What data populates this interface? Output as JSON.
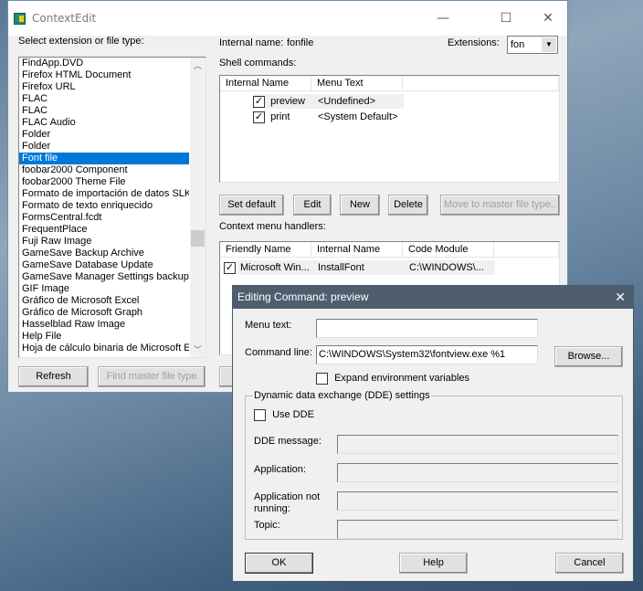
{
  "main": {
    "title": "ContextEdit",
    "select_label": "Select extension or file type:",
    "internal_name_label": "Internal name:",
    "internal_name_value": "fonfile",
    "extensions_label": "Extensions:",
    "extensions_value": "fon",
    "file_types": [
      "FindApp.DVD",
      "Firefox HTML Document",
      "Firefox URL",
      "FLAC",
      "FLAC",
      "FLAC Audio",
      "Folder",
      "Folder",
      "Font file",
      "foobar2000 Component",
      "foobar2000 Theme File",
      "Formato de importación de datos SLK de",
      "Formato de texto enriquecido",
      "FormsCentral.fcdt",
      "FrequentPlace",
      "Fuji Raw Image",
      "GameSave Backup Archive",
      "GameSave Database Update",
      "GameSave Manager Settings backup",
      "GIF Image",
      "Gráfico de Microsoft Excel",
      "Gráfico de Microsoft Graph",
      "Hasselblad Raw Image",
      "Help File",
      "Hoja de cálculo binaria de Microsoft Excel"
    ],
    "selected_file_type": "Font file",
    "shell_label": "Shell commands:",
    "shell_headers": [
      "Internal Name",
      "Menu Text"
    ],
    "shell_rows": [
      {
        "name": "preview",
        "menu": "<Undefined>",
        "checked": true
      },
      {
        "name": "print",
        "menu": "<System Default>",
        "checked": true
      }
    ],
    "buttons": {
      "set_default": "Set default",
      "edit": "Edit",
      "new": "New",
      "delete": "Delete",
      "move": "Move to master file type..",
      "refresh": "Refresh",
      "find_master": "Find master file type"
    },
    "handlers_label": "Context menu handlers:",
    "handler_headers": [
      "Friendly Name",
      "Internal Name",
      "Code Module"
    ],
    "handler_rows": [
      {
        "friendly": "Microsoft Win...",
        "internal": "InstallFont",
        "module": "C:\\WINDOWS\\...",
        "checked": true
      }
    ]
  },
  "dialog": {
    "title": "Editing Command: preview",
    "menu_text_label": "Menu text:",
    "menu_text_value": "",
    "command_line_label": "Command line:",
    "command_line_value": "C:\\WINDOWS\\System32\\fontview.exe %1",
    "browse": "Browse...",
    "expand_env": "Expand environment variables",
    "expand_env_checked": false,
    "dde_group": "Dynamic data exchange (DDE) settings",
    "use_dde": "Use DDE",
    "use_dde_checked": false,
    "dde_message_label": "DDE message:",
    "application_label": "Application:",
    "app_not_running_label": "Application not running:",
    "topic_label": "Topic:",
    "ok": "OK",
    "help": "Help",
    "cancel": "Cancel"
  }
}
